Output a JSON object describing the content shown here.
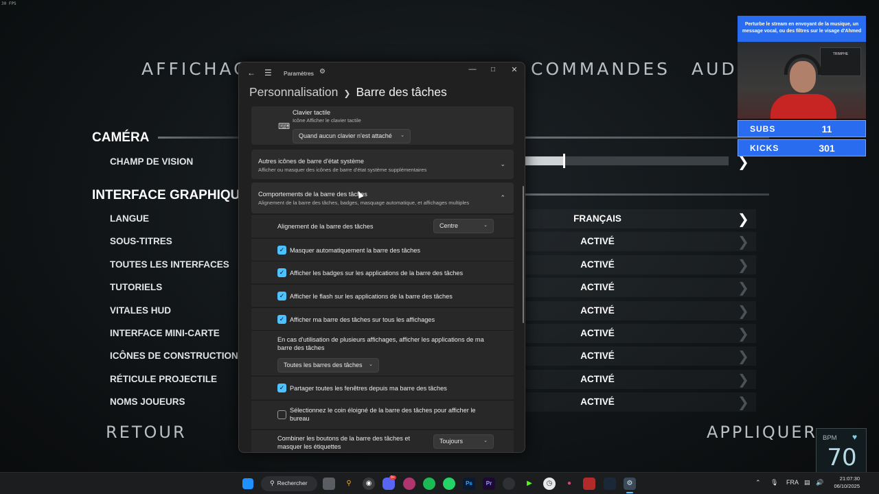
{
  "fps_counter": "30 FPS",
  "game": {
    "tabs": [
      "AFFICHAGE",
      "COMMANDES",
      "AUDIO"
    ],
    "sections": {
      "camera": "CAMÉRA",
      "interface": "INTERFACE GRAPHIQUE"
    },
    "camera_item": "CHAMP DE VISION",
    "fov_slider_fraction": 0.19,
    "interface_items": [
      {
        "label": "LANGUE",
        "value": "FRANÇAIS"
      },
      {
        "label": "SOUS-TITRES",
        "value": "ACTIVÉ"
      },
      {
        "label": "TOUTES LES INTERFACES",
        "value": "ACTIVÉ"
      },
      {
        "label": "TUTORIELS",
        "value": "ACTIVÉ"
      },
      {
        "label": "VITALES HUD",
        "value": "ACTIVÉ"
      },
      {
        "label": "INTERFACE MINI-CARTE",
        "value": "ACTIVÉ"
      },
      {
        "label": "ICÔNES DE CONSTRUCTION",
        "value": "ACTIVÉ"
      },
      {
        "label": "RÉTICULE PROJECTILE",
        "value": "ACTIVÉ"
      },
      {
        "label": "NOMS JOUEURS",
        "value": "ACTIVÉ"
      }
    ],
    "back_label": "RETOUR",
    "apply_label": "APPLIQUER"
  },
  "settings": {
    "app_title": "Paramètres",
    "breadcrumb": {
      "parent": "Personnalisation",
      "current": "Barre des tâches"
    },
    "touch_keyboard": {
      "title": "Clavier tactile",
      "subtitle": "Icône Afficher le clavier tactile",
      "dropdown_value": "Quand aucun clavier n'est attaché"
    },
    "tray_icons": {
      "title": "Autres icônes de barre d'état système",
      "subtitle": "Afficher ou masquer des icônes de barre d'état système supplémentaires"
    },
    "behaviors": {
      "title": "Comportements de la barre des tâches",
      "subtitle": "Alignement de la barre des tâches, badges, masquage automatique, et affichages multiples"
    },
    "alignment": {
      "label": "Alignement de la barre des tâches",
      "value": "Centre"
    },
    "checkboxes": [
      {
        "label": "Masquer automatiquement la barre des tâches",
        "checked": true
      },
      {
        "label": "Afficher les badges sur les applications de la barre des tâches",
        "checked": true
      },
      {
        "label": "Afficher le flash sur les applications de la barre des tâches",
        "checked": true
      },
      {
        "label": "Afficher ma barre des tâches sur tous les affichages",
        "checked": true
      }
    ],
    "multi_display": {
      "label": "En cas d'utilisation de plusieurs affichages, afficher les applications de ma barre des tâches",
      "value": "Toutes les barres des tâches"
    },
    "share_windows": {
      "label": "Partager toutes les fenêtres depuis ma barre des tâches",
      "checked": true
    },
    "far_corner": {
      "label": "Sélectionnez le coin éloigné de la barre des tâches pour afficher le bureau",
      "checked": false
    },
    "combine": {
      "label": "Combiner les boutons de la barre des tâches et masquer les étiquettes",
      "value": "Toujours"
    }
  },
  "stream": {
    "banner": "Perturbe le stream en envoyant de la musique, un message vocal, ou des filtres sur le visage d'Ahmed",
    "webcam_sign": "TRIMPHE",
    "subs_label": "SUBS",
    "subs_value": "11",
    "kicks_label": "KICKS",
    "kicks_value": "301",
    "bpm_label": "BPM",
    "bpm_value": "70"
  },
  "taskbar": {
    "search_label": "Rechercher",
    "language": "FRA",
    "time": "21:07:30",
    "date": "06/10/2025",
    "discord_badge": "9+"
  },
  "colors": {
    "accent": "#4cc2ff",
    "stream_blue": "#2a6cf0",
    "window_bg": "#202020"
  }
}
